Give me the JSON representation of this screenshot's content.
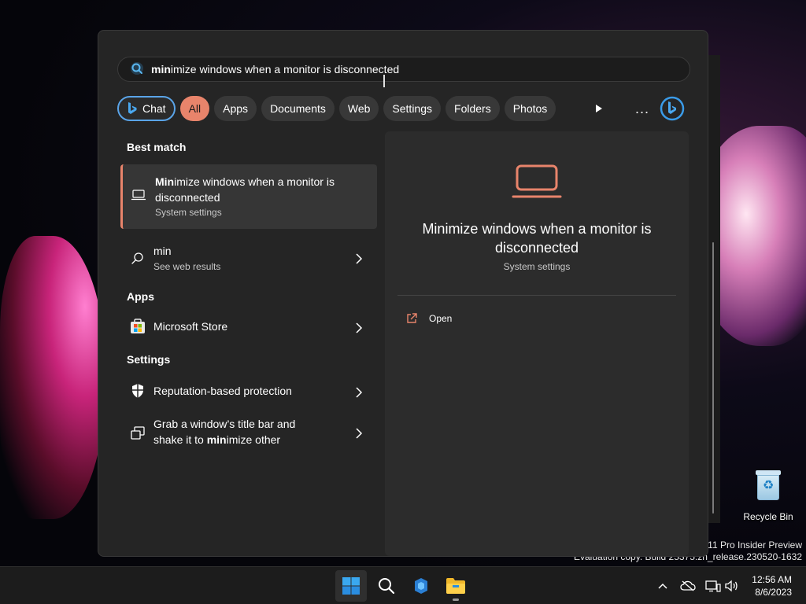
{
  "search": {
    "query_bold": "min",
    "query_rest": "imize windows when a monitor is disconnected"
  },
  "filters": {
    "chat": "Chat",
    "items": [
      "All",
      "Apps",
      "Documents",
      "Web",
      "Settings",
      "Folders",
      "Photos"
    ],
    "more": "..."
  },
  "results": {
    "best_match_header": "Best match",
    "best": {
      "title_bold": "Min",
      "title_rest": "imize windows when a monitor is disconnected",
      "subtitle": "System settings",
      "icon": "laptop-icon"
    },
    "web": {
      "title": "min",
      "subtitle": "See web results",
      "icon": "search-icon"
    },
    "apps_header": "Apps",
    "apps": [
      {
        "label": "Microsoft Store",
        "icon": "microsoft-store-icon"
      }
    ],
    "settings_header": "Settings",
    "settings": [
      {
        "label": "Reputation-based protection",
        "icon": "shield-icon"
      },
      {
        "label_a": "Grab a window’s title bar and shake it to ",
        "label_bold": "min",
        "label_b": "imize other",
        "icon": "windows-stack-icon"
      }
    ]
  },
  "preview": {
    "title": "Minimize windows when a monitor is disconnected",
    "subtitle": "System settings",
    "action_open": "Open",
    "accent": "#e8846b"
  },
  "desktop": {
    "recycle_bin": "Recycle Bin",
    "watermark_line1": "s 11 Pro Insider Preview",
    "watermark_line2": "Evaluation copy. Build 25375.zn_release.230520-1632"
  },
  "taskbar": {
    "time": "12:56 AM",
    "date": "8/6/2023"
  },
  "colors": {
    "accent": "#e8846b",
    "chat_border": "#5aa4e8",
    "flyout_bg": "#252525"
  }
}
